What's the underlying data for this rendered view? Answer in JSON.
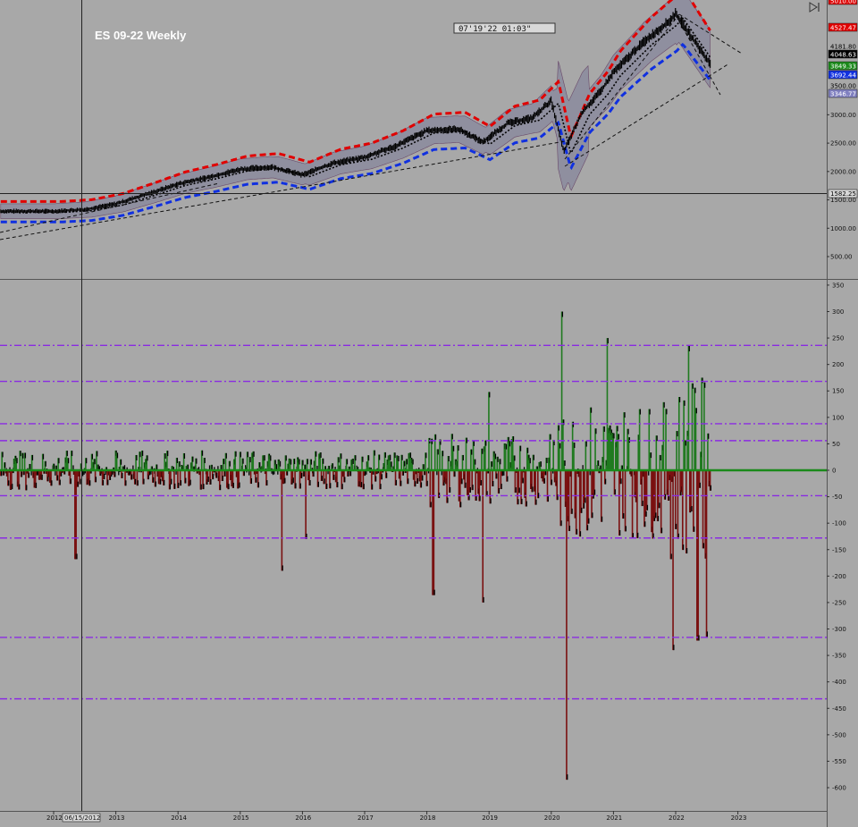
{
  "chart_title": "ES  09-22  Weekly",
  "timestamp": "07'19'22  01:03\"",
  "crosshair": {
    "date_label": "06/15/2012",
    "price_label": "1582.25"
  },
  "colors": {
    "background": "#a8a8a8",
    "up_bar": "#1f7a1f",
    "down_bar": "#7a1010",
    "upper_band": "#e00000",
    "lower_band": "#1030e0",
    "level_line": "#8a2be2",
    "zero_line": "#1a8a1a"
  },
  "price_axis_badges": [
    {
      "label": "5010.00",
      "bg": "#e00000",
      "fg": "#ffffff"
    },
    {
      "label": "4527.47",
      "bg": "#e00000",
      "fg": "#ffffff"
    },
    {
      "label": "4181.80",
      "bg": "#a8a8a8",
      "fg": "#000000"
    },
    {
      "label": "4048.63",
      "bg": "#000000",
      "fg": "#ffffff"
    },
    {
      "label": "3849.33",
      "bg": "#1a8a1a",
      "fg": "#ffffff"
    },
    {
      "label": "3692.44",
      "bg": "#1030e0",
      "fg": "#ffffff"
    },
    {
      "label": "3500.00",
      "bg": "#a8a8a8",
      "fg": "#000000"
    },
    {
      "label": "3346.77",
      "bg": "#8080c0",
      "fg": "#ffffff"
    }
  ],
  "chart_data": [
    {
      "type": "line",
      "panel": "price",
      "title": "ES  09-22  Weekly",
      "y_ticks": [
        "3000.00",
        "2500.00",
        "2000.00",
        "1500.00",
        "1000.00",
        "500.00"
      ],
      "ylim": [
        150,
        5100
      ],
      "x": [
        "2012",
        "2012.5",
        "2013",
        "2013.5",
        "2014",
        "2014.5",
        "2015",
        "2015.5",
        "2016",
        "2016.5",
        "2017",
        "2017.5",
        "2018",
        "2018.5",
        "2018.9",
        "2019.3",
        "2019.7",
        "2020.0",
        "2020.2",
        "2020.5",
        "2020.8",
        "2021.0",
        "2021.5",
        "2021.9",
        "2022.0",
        "2022.3",
        "2022.55"
      ],
      "series": [
        {
          "values": [
            1300,
            1330,
            1430,
            1600,
            1780,
            1900,
            2040,
            2080,
            1940,
            2150,
            2250,
            2450,
            2720,
            2750,
            2520,
            2850,
            2950,
            3250,
            2350,
            3050,
            3420,
            3750,
            4300,
            4650,
            4780,
            4300,
            3900
          ]
        }
      ]
    },
    {
      "type": "bar",
      "panel": "oscillator",
      "y_ticks": [
        "350",
        "300",
        "250",
        "200",
        "150",
        "100",
        "50",
        "0",
        "-50",
        "-100",
        "-150",
        "-200",
        "-250",
        "-300",
        "-350",
        "-400",
        "-450",
        "-500",
        "-550",
        "-600"
      ],
      "ylim": [
        -650,
        360
      ],
      "levels": [
        236,
        168,
        88,
        56,
        -48,
        -128,
        -316,
        -432
      ],
      "spikes": [
        {
          "x": 2012.35,
          "value": -168
        },
        {
          "x": 2015.67,
          "value": -190
        },
        {
          "x": 2016.05,
          "value": -130
        },
        {
          "x": 2018.1,
          "value": -236
        },
        {
          "x": 2018.9,
          "value": -250
        },
        {
          "x": 2019.0,
          "value": 148
        },
        {
          "x": 2020.17,
          "value": 300
        },
        {
          "x": 2020.25,
          "value": -585
        },
        {
          "x": 2020.9,
          "value": 250
        },
        {
          "x": 2021.95,
          "value": -340
        },
        {
          "x": 2022.2,
          "value": 235
        },
        {
          "x": 2022.35,
          "value": -322
        },
        {
          "x": 2022.42,
          "value": 175
        },
        {
          "x": 2022.5,
          "value": -315
        }
      ],
      "x_ticks": [
        "2012",
        "2013",
        "2014",
        "2015",
        "2016",
        "2017",
        "2018",
        "2019",
        "2020",
        "2021",
        "2022",
        "2023"
      ]
    }
  ]
}
